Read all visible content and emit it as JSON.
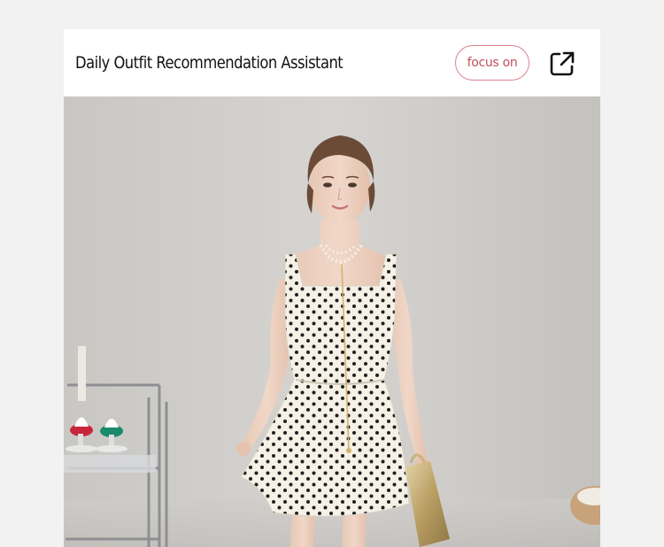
{
  "header": {
    "title": "Daily Outfit Recommendation Assistant",
    "focus_label": "focus on",
    "share_icon": "external-link-icon"
  },
  "photo": {
    "icon": "outfit-photo",
    "accent": "#d9848e"
  }
}
